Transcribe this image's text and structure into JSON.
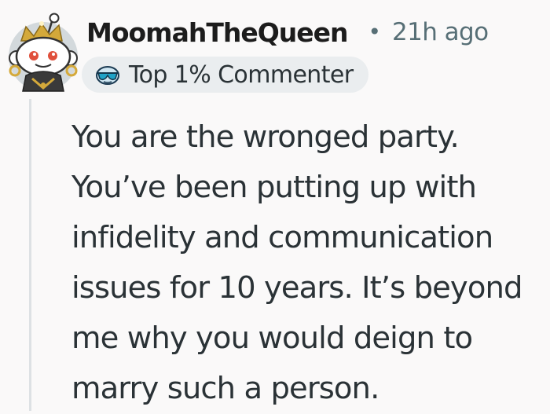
{
  "comment": {
    "username": "MoomahTheQueen",
    "separator": "•",
    "time_ago": "21h ago",
    "flair": {
      "icon": "snoo-sunglasses-icon",
      "text": "Top 1% Commenter"
    },
    "body_lines": [
      "You are the wronged party.",
      "You’ve been putting up with",
      "infidelity and communication",
      "issues for 10 years. It’s beyond",
      "me why you would deign to",
      "marry such a person."
    ]
  },
  "colors": {
    "background": "#faf9f9",
    "username": "#1c1c1c",
    "meta": "#576f76",
    "body_text": "#2a3236",
    "flair_bg": "#eaedef",
    "thread_line": "#dde1e4"
  }
}
